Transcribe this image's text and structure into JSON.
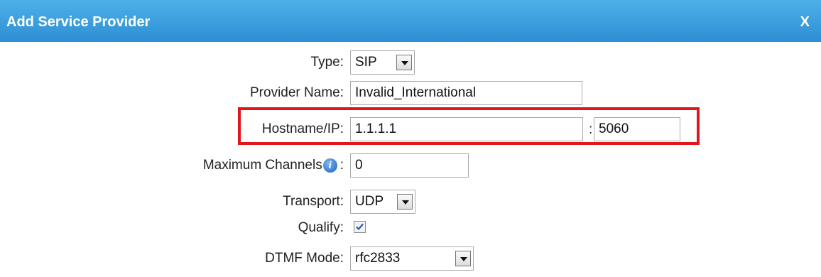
{
  "dialog": {
    "title": "Add Service Provider",
    "close_label": "X"
  },
  "form": {
    "type_label": "Type:",
    "type_value": "SIP",
    "provider_name_label": "Provider Name:",
    "provider_name_value": "Invalid_International",
    "hostname_label": "Hostname/IP:",
    "hostname_value": "1.1.1.1",
    "port_separator": ":",
    "port_value": "5060",
    "max_channels_label": "Maximum Channels",
    "max_channels_colon": ":",
    "max_channels_value": "0",
    "transport_label": "Transport:",
    "transport_value": "UDP",
    "qualify_label": "Qualify:",
    "qualify_checked": true,
    "dtmf_label": "DTMF Mode:",
    "dtmf_value": "rfc2833"
  },
  "colors": {
    "titlebar": "#2c8fd3",
    "highlight_border": "#e0161c"
  }
}
